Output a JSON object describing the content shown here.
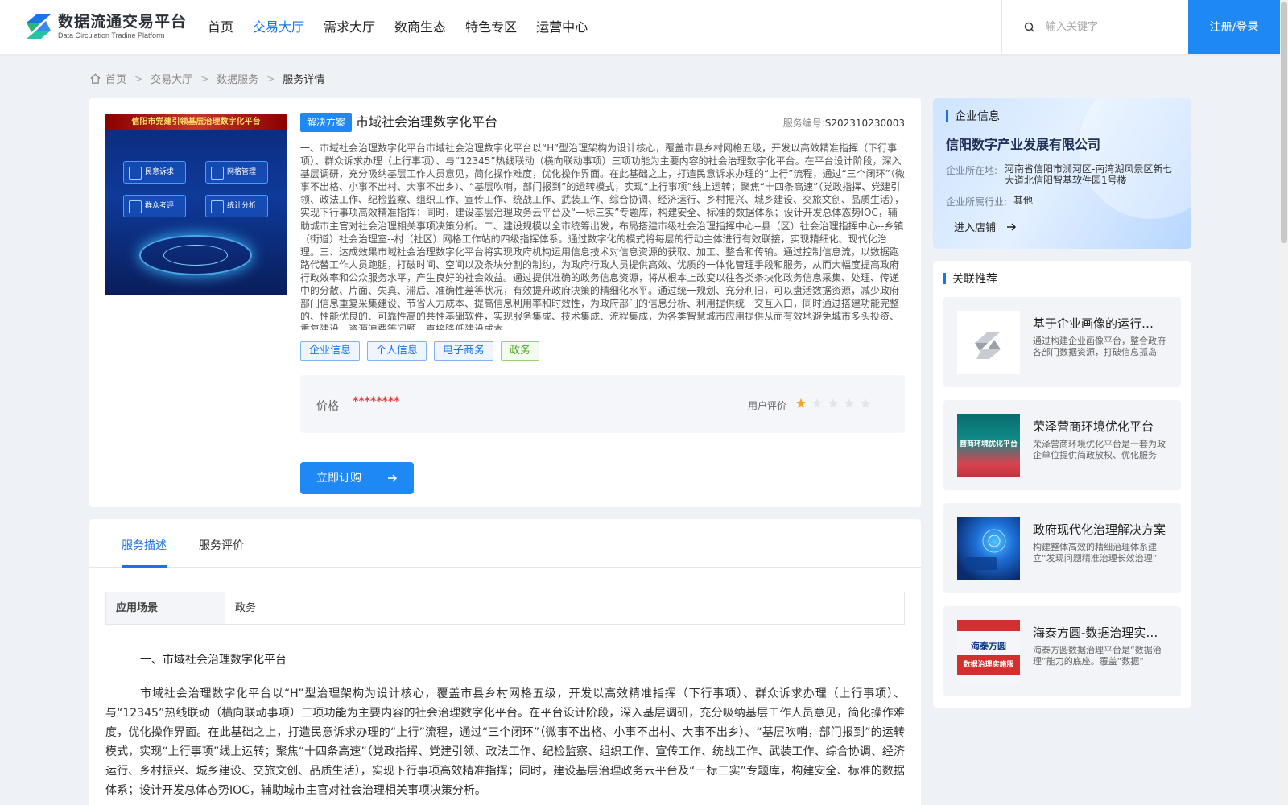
{
  "header": {
    "logo_title": "数据流通交易平台",
    "logo_subtitle": "Data Circulation Tradine Platform",
    "nav": [
      {
        "label": "首页",
        "active": false
      },
      {
        "label": "交易大厅",
        "active": true
      },
      {
        "label": "需求大厅",
        "active": false
      },
      {
        "label": "数商生态",
        "active": false
      },
      {
        "label": "特色专区",
        "active": false
      },
      {
        "label": "运营中心",
        "active": false
      }
    ],
    "search_placeholder": "输入关键字",
    "login_label": "注册/登录"
  },
  "breadcrumb": [
    "首页",
    "交易大厅",
    "数据服务",
    "服务详情"
  ],
  "product": {
    "image_banner": "信阳市党建引领基层治理数字化平台",
    "image_tiles": [
      "民意诉求",
      "网格管理",
      "群众考评",
      "统计分析"
    ],
    "type_tag": "解决方案",
    "title": "市域社会治理数字化平台",
    "service_no_label": "服务编号:",
    "service_no": "S202310230003",
    "description": "一、市域社会治理数字化平台市域社会治理数字化平台以“H”型治理架构为设计核心，覆盖市县乡村网格五级，开发以高效精准指挥（下行事项）、群众诉求办理（上行事项）、与“12345”热线联动（横向联动事项）三项功能为主要内容的社会治理数字化平台。在平台设计阶段，深入基层调研，充分吸纳基层工作人员意见，简化操作难度，优化操作界面。在此基础之上，打造民意诉求办理的“上行”流程，通过“三个闭环”（微事不出格、小事不出村、大事不出乡）、“基层吹哨，部门报到”的运转模式，实现“上行事项”线上运转；聚焦“十四条高速”（党政指挥、党建引领、政法工作、纪检监察、组织工作、宣传工作、统战工作、武装工作、综合协调、经济运行、乡村振兴、城乡建设、交旅文创、品质生活），实现下行事项高效精准指挥；同时，建设基层治理政务云平台及“一标三实”专题库，构建安全、标准的数据体系；设计开发总体态势IOC，辅助城市主官对社会治理相关事项决策分析。二、建设规模以全市统筹出发，布局搭建市级社会治理指挥中心--县（区）社会治理指挥中心--乡镇（街道）社会治理室--村（社区）网格工作站的四级指挥体系。通过数字化的模式将每层的行动主体进行有效联接，实现精细化、现代化治理。三、达成效果市域社会治理数字化平台将实现政府机构运用信息技术对信息资源的获取、加工、整合和传输。通过控制信息流，以数据跑路代替工作人员跑腿，打破时间、空间以及条块分割的制约，为政府行政人员提供高效、优质的一体化管理手段和服务，从而大幅度提高政府行政效率和公众服务水平，产生良好的社会效益。通过提供准确的政务信息资源，将从根本上改变以往各类条块化政务信息采集、处理、传递中的分散、片面、失真、滞后、准确性差等状况，有效提升政府决策的精细化水平。通过统一规划、充分利旧，可以盘活数据资源，减少政府部门信息重复采集建设、节省人力成本、提高信息利用率和时效性，为政府部门的信息分析、利用提供统一交互入口，同时通过搭建功能完整的、性能优良的、可靠性高的共性基础软件，实现服务集成、技术集成、流程集成，为各类智慧城市应用提供从而有效地避免城市多头投资、重复建设、资源浪费等问题，直接降低建设成本。",
    "tags": [
      {
        "label": "企业信息",
        "color": "blue"
      },
      {
        "label": "个人信息",
        "color": "blue"
      },
      {
        "label": "电子商务",
        "color": "blue"
      },
      {
        "label": "政务",
        "color": "green"
      }
    ],
    "price_label": "价格",
    "price_value": "********",
    "rating_label": "用户评价",
    "rating": 1,
    "rating_max": 5,
    "buy_label": "立即订购"
  },
  "detail": {
    "tabs": [
      {
        "label": "服务描述",
        "active": true
      },
      {
        "label": "服务评价",
        "active": false
      }
    ],
    "scene_key": "应用场景",
    "scene_value": "政务",
    "section_heading": "一、市域社会治理数字化平台",
    "paragraph": "市域社会治理数字化平台以“H”型治理架构为设计核心，覆盖市县乡村网格五级，开发以高效精准指挥（下行事项）、群众诉求办理（上行事项）、与“12345”热线联动（横向联动事项）三项功能为主要内容的社会治理数字化平台。在平台设计阶段，深入基层调研，充分吸纳基层工作人员意见，简化操作难度，优化操作界面。在此基础之上，打造民意诉求办理的“上行”流程，通过“三个闭环”（微事不出格、小事不出村、大事不出乡）、“基层吹哨，部门报到”的运转模式，实现“上行事项”线上运转；聚焦“十四条高速”（党政指挥、党建引领、政法工作、纪检监察、组织工作、宣传工作、统战工作、武装工作、综合协调、经济运行、乡村振兴、城乡建设、交旅文创、品质生活），实现下行事项高效精准指挥；同时，建设基层治理政务云平台及“一标三实”专题库，构建安全、标准的数据体系；设计开发总体态势IOC，辅助城市主官对社会治理相关事项决策分析。"
  },
  "company": {
    "section_title": "企业信息",
    "name": "信阳数字产业发展有限公司",
    "location_label": "企业所在地:",
    "location": "河南省信阳市浉河区-南湾湖风景区新七大道北信阳智基软件园1号楼",
    "industry_label": "企业所属行业:",
    "industry": "其他",
    "enter_label": "进入店铺"
  },
  "recommend": {
    "section_title": "关联推荐",
    "items": [
      {
        "title": "基于企业画像的运行监测平台",
        "desc": "通过构建企业画像平台，整合政府各部门数据资源，打破信息孤岛",
        "thumb": "logo"
      },
      {
        "title": "荣泽营商环境优化平台",
        "desc": "荣泽营商环境优化平台是一套为政企单位提供简政放权、优化服务",
        "thumb": "business",
        "thumb_text": "营商环境优化平台"
      },
      {
        "title": "政府现代化治理解决方案",
        "desc": "构建整体高效的精细治理体系建立“发现问题精准治理长效治理”",
        "thumb": "tech"
      },
      {
        "title": "海泰方圆-数据治理实施服务",
        "desc": "海泰方圆数据治理平台是“数据治理”能力的底座。覆盖“数据”",
        "thumb": "poster",
        "thumb_text_top": "海泰方圆",
        "thumb_text_bottom": "数据治理实施服"
      }
    ]
  },
  "colors": {
    "accent": "#1e88f5",
    "price": "#e83e3e",
    "star": "#f5a623",
    "tag_green": "#52a82f"
  }
}
